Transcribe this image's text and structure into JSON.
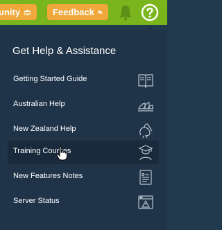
{
  "topbar": {
    "community_label": "unity",
    "feedback_label": "Feedback"
  },
  "help_menu": {
    "title": "Get Help & Assistance",
    "items": [
      {
        "label": "Getting Started Guide",
        "icon": "book-icon"
      },
      {
        "label": "Australian Help",
        "icon": "sydney-opera-house-icon"
      },
      {
        "label": "New Zealand Help",
        "icon": "kiwi-bird-icon"
      },
      {
        "label": "Training Courses",
        "icon": "graduate-icon"
      },
      {
        "label": "New Features Notes",
        "icon": "notes-icon"
      },
      {
        "label": "Server Status",
        "icon": "server-warning-icon"
      }
    ]
  },
  "colors": {
    "topbar": "#7ab51d",
    "pill": "#f0a83a",
    "panel": "#1f3449",
    "active_item": "#182a3b"
  }
}
